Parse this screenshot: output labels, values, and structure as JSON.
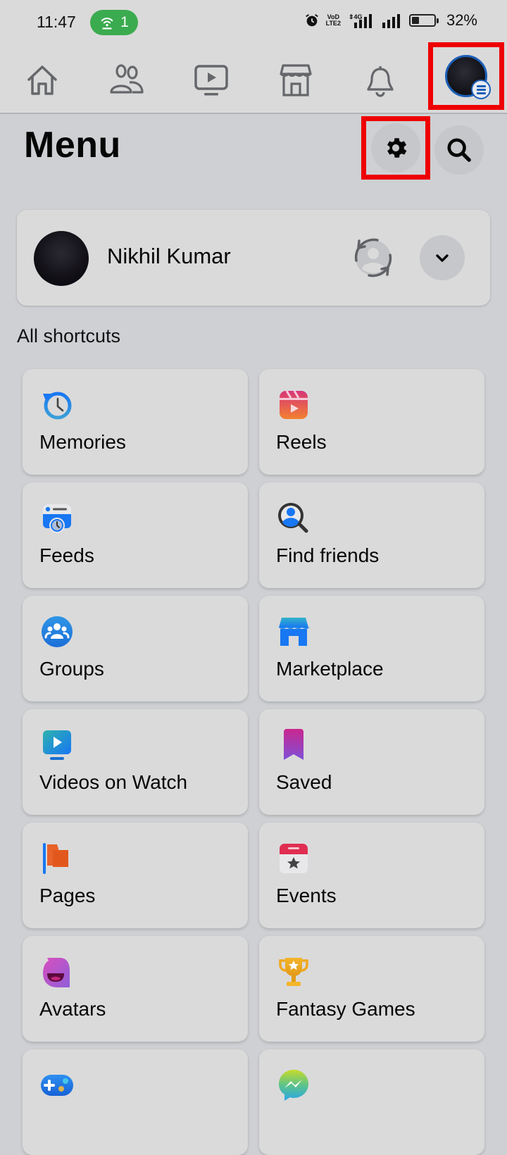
{
  "status_bar": {
    "time": "11:47",
    "hotspot_count": "1",
    "network_label_top": "VoD",
    "network_label_bottom": "LTE2",
    "network_type": "4G",
    "battery": "32%",
    "battery_level": 0.32
  },
  "nav": {
    "items": [
      {
        "name": "home",
        "icon": "home-icon"
      },
      {
        "name": "friends",
        "icon": "friends-icon"
      },
      {
        "name": "watch",
        "icon": "video-icon"
      },
      {
        "name": "marketplace",
        "icon": "store-icon"
      },
      {
        "name": "notifications",
        "icon": "bell-icon"
      },
      {
        "name": "menu",
        "icon": "profile-menu-icon",
        "highlighted": true
      }
    ]
  },
  "header": {
    "title": "Menu",
    "settings_icon": "gear-icon",
    "search_icon": "search-icon",
    "highlight_color": "#ee0000"
  },
  "profile": {
    "name": "Nikhil Kumar",
    "switch_icon": "switch-profile-icon",
    "expand_icon": "chevron-down-icon"
  },
  "shortcuts": {
    "label": "All shortcuts",
    "items": [
      {
        "label": "Memories",
        "icon": "memories-icon"
      },
      {
        "label": "Reels",
        "icon": "reels-icon"
      },
      {
        "label": "Feeds",
        "icon": "feeds-icon"
      },
      {
        "label": "Find friends",
        "icon": "find-friends-icon"
      },
      {
        "label": "Groups",
        "icon": "groups-icon"
      },
      {
        "label": "Marketplace",
        "icon": "marketplace-icon"
      },
      {
        "label": "Videos on Watch",
        "icon": "watch-icon"
      },
      {
        "label": "Saved",
        "icon": "saved-icon"
      },
      {
        "label": "Pages",
        "icon": "pages-icon"
      },
      {
        "label": "Events",
        "icon": "events-icon"
      },
      {
        "label": "Avatars",
        "icon": "avatars-icon"
      },
      {
        "label": "Fantasy Games",
        "icon": "fantasy-games-icon"
      },
      {
        "label": "",
        "icon": "gaming-icon"
      },
      {
        "label": "",
        "icon": "messenger-icon"
      }
    ]
  },
  "colors": {
    "background": "#ced0d3",
    "card": "#dadada",
    "accent_blue": "#1b74e4",
    "hotspot_green": "#3bab4f"
  }
}
